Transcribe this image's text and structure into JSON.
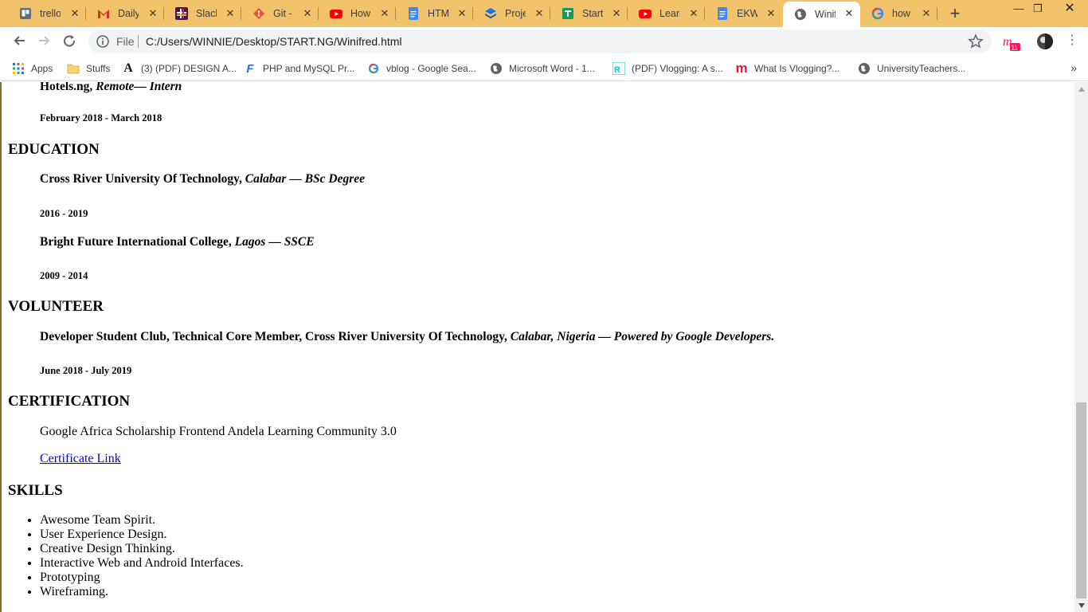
{
  "tabs": [
    {
      "title": "trello.com",
      "icon": "trello-icon"
    },
    {
      "title": "Daily Updates",
      "icon": "gmail-icon"
    },
    {
      "title": "Slack | HNG",
      "icon": "slack-icon"
    },
    {
      "title": "Git - Documentation",
      "icon": "git-icon"
    },
    {
      "title": "How to",
      "icon": "youtube-icon"
    },
    {
      "title": "HTML",
      "icon": "docs-icon"
    },
    {
      "title": "Project",
      "icon": "layers-icon"
    },
    {
      "title": "StartNG",
      "icon": "sheets-icon"
    },
    {
      "title": "Learn",
      "icon": "youtube-icon"
    },
    {
      "title": "EKWU",
      "icon": "docs-icon"
    },
    {
      "title": "Winifred",
      "icon": "globe-icon",
      "active": true
    },
    {
      "title": "how do",
      "icon": "google-icon"
    }
  ],
  "omnibox": {
    "scheme_label": "File",
    "url": "C:/Users/WINNIE/Desktop/START.NG/Winifred.html"
  },
  "bookmarks": [
    {
      "label": "Apps",
      "icon": "apps-grid-icon"
    },
    {
      "label": "Stuffs",
      "icon": "folder-icon"
    },
    {
      "label": "(3) (PDF) DESIGN A...",
      "icon": "academia-icon"
    },
    {
      "label": "PHP and MySQL Pr...",
      "icon": "f-icon"
    },
    {
      "label": "vblog - Google Sea...",
      "icon": "google-icon"
    },
    {
      "label": "Microsoft Word - 1...",
      "icon": "globe-icon"
    },
    {
      "label": "(PDF) Vlogging: A s...",
      "icon": "researchgate-icon"
    },
    {
      "label": "What Is Vlogging?...",
      "icon": "m-icon"
    },
    {
      "label": "UniversityTeachers...",
      "icon": "globe-icon"
    }
  ],
  "resume": {
    "experience_tail": {
      "org": "Hotels.ng,",
      "detail": " Remote— Intern",
      "dates": "February 2018 - March 2018"
    },
    "education": {
      "heading": "EDUCATION",
      "items": [
        {
          "org": "Cross River University Of Technology,",
          "detail": " Calabar — BSc Degree",
          "dates": "2016 - 2019"
        },
        {
          "org": "Bright Future International College,",
          "detail": " Lagos — SSCE",
          "dates": "2009 - 2014"
        }
      ]
    },
    "volunteer": {
      "heading": "VOLUNTEER",
      "org": "Developer Student Club, Technical Core Member, Cross River University Of Technology,",
      "detail": " Calabar, Nigeria — Powered by Google Developers.",
      "dates": "June 2018 - July 2019"
    },
    "certification": {
      "heading": "CERTIFICATION",
      "text": "Google Africa Scholarship Frontend Andela Learning Community 3.0",
      "link_label": "Certificate Link"
    },
    "skills": {
      "heading": "SKILLS",
      "items": [
        "Awesome Team Spirit.",
        "User Experience Design.",
        "Creative Design Thinking.",
        "Interactive Web and Android Interfaces.",
        "Prototyping",
        "Wireframing."
      ]
    }
  },
  "colors": {
    "tabstrip": "#f2c36b",
    "link": "#0000ee"
  }
}
